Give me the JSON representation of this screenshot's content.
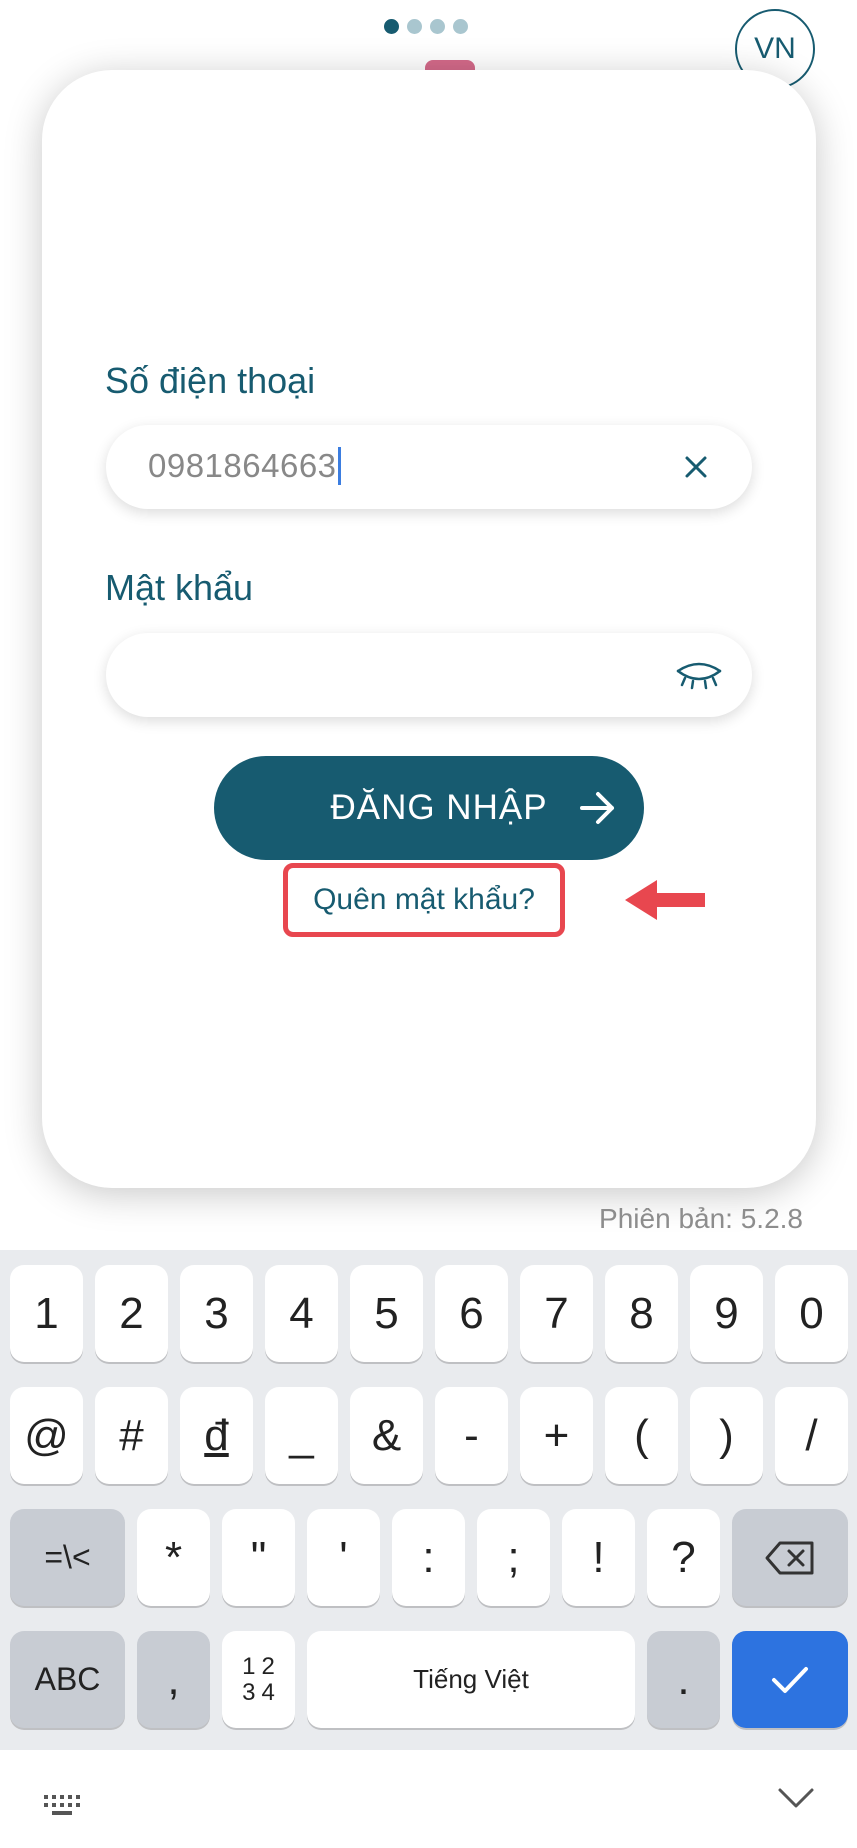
{
  "header": {
    "language": "VN",
    "page_indicator": {
      "count": 4,
      "active": 1
    }
  },
  "login": {
    "phone_label": "Số điện thoại",
    "phone_value": "0981864663",
    "password_label": "Mật khẩu",
    "password_value": "",
    "submit_label": "ĐĂNG NHẬP",
    "forgot_link": "Quên mật khẩu?"
  },
  "version": "Phiên bản: 5.2.8",
  "keyboard": {
    "row1": [
      "1",
      "2",
      "3",
      "4",
      "5",
      "6",
      "7",
      "8",
      "9",
      "0"
    ],
    "row2": [
      "@",
      "#",
      "đ",
      "_",
      "&",
      "-",
      "+",
      "(",
      ")",
      "/"
    ],
    "row3": {
      "switch": "=\\<",
      "keys": [
        "*",
        "\"",
        "'",
        ":",
        ";",
        "!",
        "?"
      ],
      "backspace_icon": "backspace-icon"
    },
    "row4": {
      "abc": "ABC",
      "comma": ",",
      "numpad": [
        "1",
        "2",
        "3",
        "4"
      ],
      "space": "Tiếng Việt",
      "period": ".",
      "done_icon": "check-icon"
    }
  },
  "colors": {
    "primary": "#175b70",
    "annotation_red": "#e8474f",
    "keyboard_bg": "#e9ebee",
    "done_key": "#2d73e0"
  },
  "icons": [
    "clear-icon",
    "eye-closed-icon",
    "arrow-right-icon",
    "backspace-icon",
    "check-icon",
    "keyboard-icon",
    "chevron-down-icon"
  ]
}
